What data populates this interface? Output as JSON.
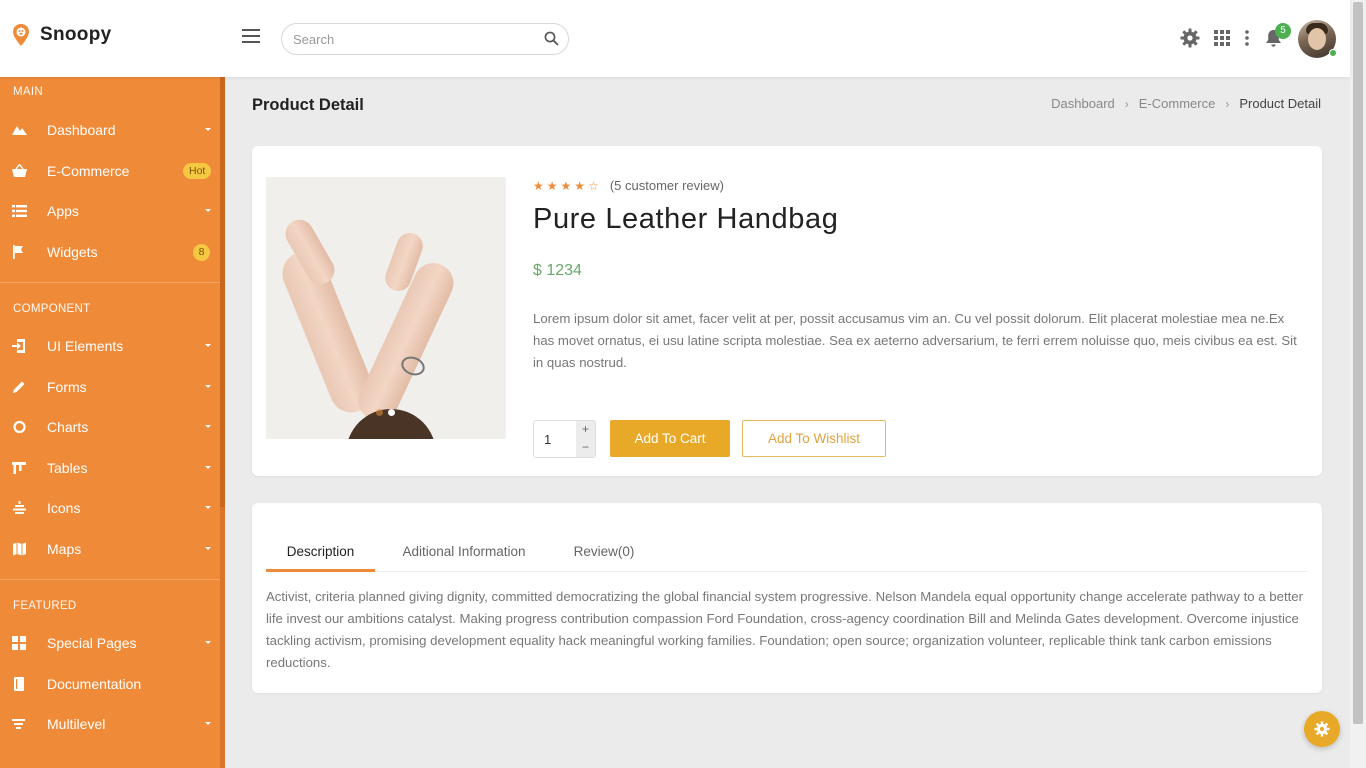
{
  "brand": {
    "name": "Snoopy"
  },
  "search": {
    "placeholder": "Search"
  },
  "header": {
    "notification_count": "5"
  },
  "sidebar": {
    "sections": [
      {
        "title": "MAIN"
      },
      {
        "title": "COMPONENT"
      },
      {
        "title": "FEATURED"
      }
    ],
    "items": [
      {
        "label": "Dashboard"
      },
      {
        "label": "E-Commerce",
        "badge": "Hot"
      },
      {
        "label": "Apps"
      },
      {
        "label": "Widgets",
        "badge": "8"
      },
      {
        "label": "UI Elements"
      },
      {
        "label": "Forms"
      },
      {
        "label": "Charts"
      },
      {
        "label": "Tables"
      },
      {
        "label": "Icons"
      },
      {
        "label": "Maps"
      },
      {
        "label": "Special Pages"
      },
      {
        "label": "Documentation"
      },
      {
        "label": "Multilevel"
      }
    ]
  },
  "page": {
    "title": "Product Detail",
    "breadcrumb": [
      "Dashboard",
      "E-Commerce",
      "Product Detail"
    ]
  },
  "product": {
    "rating": 4,
    "rating_max": 5,
    "review_text": "(5 customer review)",
    "name": "Pure Leather Handbag",
    "price": "$ 1234",
    "description": "Lorem ipsum dolor sit amet, facer velit at per, possit accusamus vim an. Cu vel possit dolorum. Elit placerat molestiae mea ne.Ex has movet ornatus, ei usu latine scripta molestiae. Sea ex aeterno adversarium, te ferri errem noluisse quo, meis civibus ea est. Sit in quas nostrud.",
    "quantity": "1",
    "plus": "+",
    "minus": "−",
    "add_to_cart": "Add To Cart",
    "add_to_wishlist": "Add To Wishlist"
  },
  "tabs": {
    "items": [
      "Description",
      "Aditional Information",
      "Review(0)"
    ],
    "active": "Description",
    "content": "Activist, criteria planned giving dignity, committed democratizing the global financial system progressive. Nelson Mandela equal opportunity change accelerate pathway to a better life invest our ambitions catalyst. Making progress contribution compassion Ford Foundation, cross-agency coordination Bill and Melinda Gates development. Overcome injustice tackling activism, promising development equality hack meaningful working families. Foundation; open source; organization volunteer, replicable think tank carbon emissions reductions."
  },
  "colors": {
    "sidebar": "#ef8b38",
    "accent": "#e8a928",
    "price": "#6aa76a",
    "badge_green": "#4caf50"
  },
  "icons": {
    "brand": "paw-pin-icon",
    "menu": "hamburger-icon",
    "search": "search-icon",
    "settings": "gear-icon",
    "apps": "grid-icon",
    "more": "dots-vertical-icon",
    "notifications": "bell-icon",
    "fab": "gear-icon"
  }
}
